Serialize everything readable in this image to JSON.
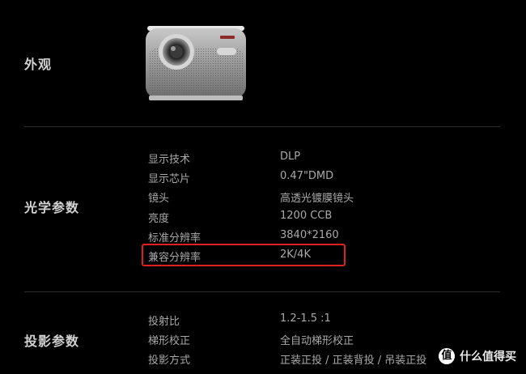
{
  "sections": {
    "appearance": {
      "title": "外观"
    },
    "optical": {
      "title": "光学参数",
      "rows": [
        {
          "label": "显示技术",
          "value": "DLP"
        },
        {
          "label": "显示芯片",
          "value": "0.47\"DMD"
        },
        {
          "label": "镜头",
          "value": "高透光镀膜镜头"
        },
        {
          "label": "亮度",
          "value": "1200 CCB"
        },
        {
          "label": "标准分辨率",
          "value": "3840*2160"
        },
        {
          "label": "兼容分辨率",
          "value": "2K/4K"
        }
      ]
    },
    "projection": {
      "title": "投影参数",
      "rows": [
        {
          "label": "投射比",
          "value": "1.2-1.5 :1"
        },
        {
          "label": "梯形校正",
          "value": "全自动梯形校正"
        },
        {
          "label": "投影方式",
          "value": "正装正投 / 正装背投 / 吊装正投"
        }
      ]
    }
  },
  "watermark": {
    "badge": "值",
    "text": "什么值得买"
  },
  "colors": {
    "highlight": "#e02020",
    "text": "#a9a9a9",
    "heading": "#d2d2d2",
    "background": "#000000"
  },
  "icons": {
    "product": "projector-image",
    "watermark": "zhi-badge-icon"
  }
}
